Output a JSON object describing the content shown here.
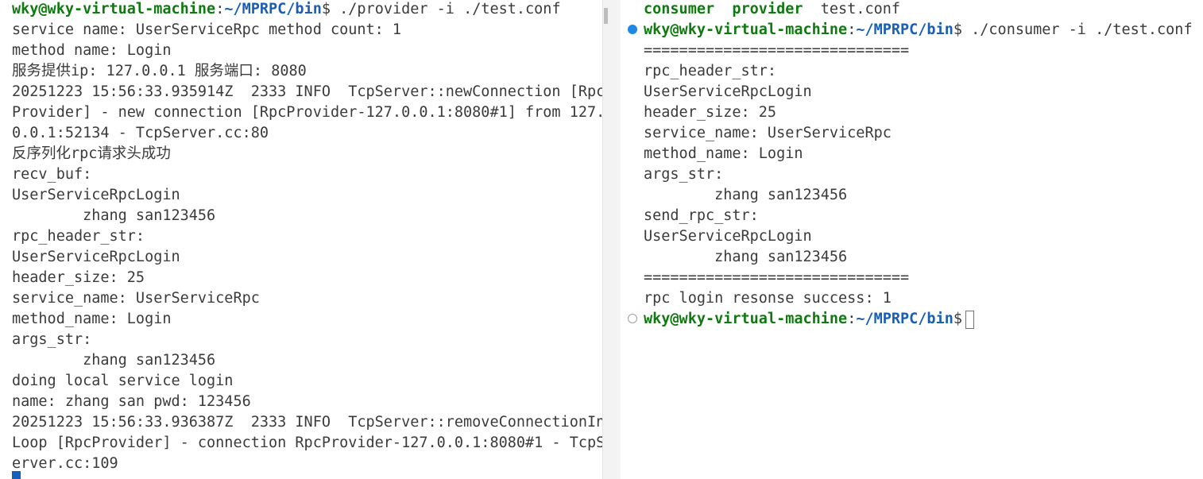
{
  "left_terminal": {
    "prompt": {
      "user": "wky@wky-virtual-machine",
      "sep": ":",
      "path": "~/MPRPC/bin",
      "suffix": "$",
      "command": " ./provider -i ./test.conf"
    },
    "lines": [
      "service name: UserServiceRpc method count: 1",
      "method name: Login",
      "服务提供ip: 127.0.0.1 服务端口: 8080",
      "20251223 15:56:33.935914Z  2333 INFO  TcpServer::newConnection [Rpc",
      "Provider] - new connection [RpcProvider-127.0.0.1:8080#1] from 127.",
      "0.0.1:52134 - TcpServer.cc:80",
      "反序列化rpc请求头成功",
      "recv_buf:",
      "UserServiceRpcLogin",
      "        zhang san123456",
      "rpc_header_str:",
      "UserServiceRpcLogin",
      "header_size: 25",
      "service_name: UserServiceRpc",
      "method_name: Login",
      "args_str:",
      "        zhang san123456",
      "doing local service login",
      "name: zhang san pwd: 123456",
      "20251223 15:56:33.936387Z  2333 INFO  TcpServer::removeConnectionIn",
      "Loop [RpcProvider] - connection RpcProvider-127.0.0.1:8080#1 - TcpS",
      "erver.cc:109"
    ]
  },
  "right_terminal": {
    "listing": [
      "consumer",
      "provider",
      "test.conf"
    ],
    "prompt1": {
      "user": "wky@wky-virtual-machine",
      "sep": ":",
      "path": "~/MPRPC/bin",
      "suffix": "$",
      "command": " ./consumer -i ./test.conf"
    },
    "lines": [
      "==============================",
      "rpc_header_str:",
      "UserServiceRpcLogin",
      "header_size: 25",
      "service_name: UserServiceRpc",
      "method_name: Login",
      "args_str:",
      "        zhang san123456",
      "send_rpc_str:",
      "UserServiceRpcLogin",
      "        zhang san123456",
      "==============================",
      "rpc login resonse success: 1"
    ],
    "prompt2": {
      "user": "wky@wky-virtual-machine",
      "sep": ":",
      "path": "~/MPRPC/bin",
      "suffix": "$"
    }
  },
  "colors": {
    "user": "#0f7a0f",
    "path": "#1a5fb4",
    "text": "#3b3b3b",
    "cursor": "#1e88e5"
  }
}
